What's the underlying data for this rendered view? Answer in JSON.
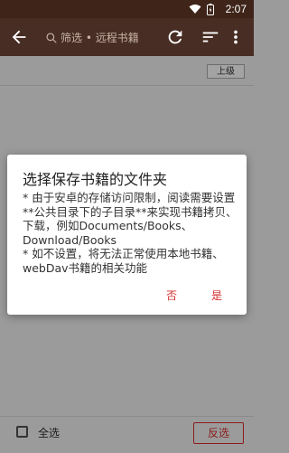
{
  "status_bar": {
    "time": "2:07",
    "icons": [
      "wifi-icon",
      "battery-icon"
    ]
  },
  "toolbar": {
    "search_placeholder": "筛选 • 远程书籍",
    "icons": [
      "back-arrow-icon",
      "search-icon",
      "refresh-icon",
      "sort-icon",
      "more-vert-icon"
    ]
  },
  "path_bar": {
    "up_label": "上级"
  },
  "bottom_bar": {
    "select_all_label": "全选",
    "invert_label": "反选"
  },
  "dialog": {
    "title": "选择保存书籍的文件夹",
    "message": "* 由于安卓的存储访问限制，阅读需要设置**公共目录下的子目录**来实现书籍拷贝、下载，例如Documents/Books、Download/Books\n* 如不设置，将无法正常使用本地书籍、webDav书籍的相关功能",
    "negative_label": "否",
    "positive_label": "是"
  },
  "colors": {
    "toolbar": "#472d23",
    "status_bar": "#3e2419",
    "accent": "#d32f2f",
    "scrim": "#9b9b9b"
  }
}
